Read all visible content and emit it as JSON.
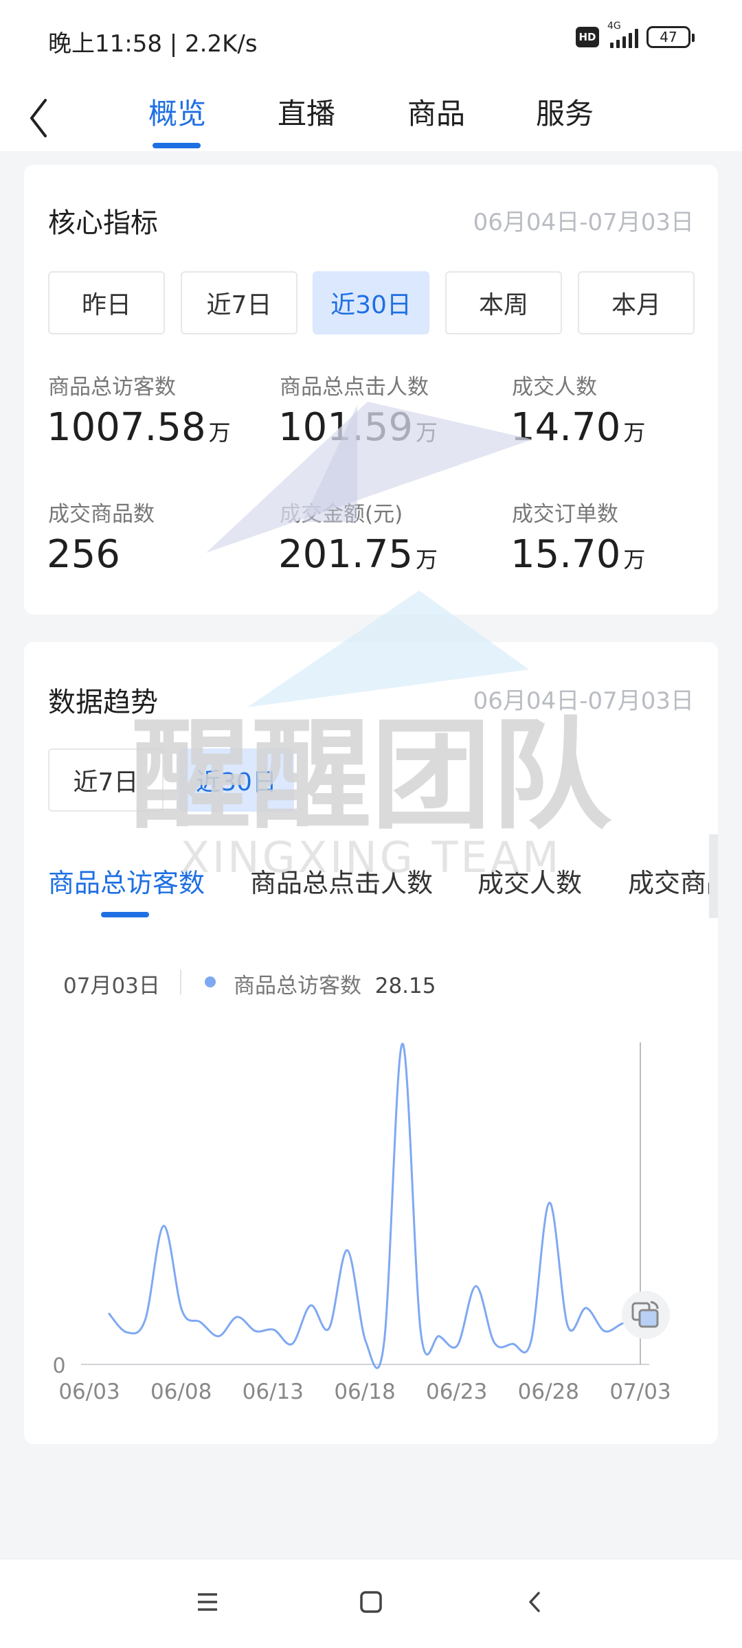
{
  "status_bar": {
    "time": "晚上11:58 | 2.2K/s",
    "network": "4G",
    "hd": "HD",
    "battery": "47"
  },
  "header": {
    "tabs": [
      {
        "label": "概览",
        "active": true
      },
      {
        "label": "直播",
        "active": false
      },
      {
        "label": "商品",
        "active": false
      },
      {
        "label": "服务",
        "active": false
      }
    ]
  },
  "core_metrics": {
    "title": "核心指标",
    "date_range": "06月04日-07月03日",
    "ranges": [
      "昨日",
      "近7日",
      "近30日",
      "本周",
      "本月"
    ],
    "selected_range": "近30日",
    "metrics": [
      {
        "label": "商品总访客数",
        "value": "1007.58",
        "unit": "万"
      },
      {
        "label": "商品总点击人数",
        "value": "101.59",
        "unit": "万"
      },
      {
        "label": "成交人数",
        "value": "14.70",
        "unit": "万"
      },
      {
        "label": "成交商品数",
        "value": "256",
        "unit": ""
      },
      {
        "label": "成交金额(元)",
        "value": "201.75",
        "unit": "万"
      },
      {
        "label": "成交订单数",
        "value": "15.70",
        "unit": "万"
      }
    ]
  },
  "data_trend": {
    "title": "数据趋势",
    "date_range": "06月04日-07月03日",
    "ranges": [
      "近7日",
      "近30日"
    ],
    "selected_range": "近30日",
    "metric_tabs": [
      "商品总访客数",
      "商品总点击人数",
      "成交人数",
      "成交商品"
    ],
    "active_metric": "商品总访客数",
    "tooltip": {
      "date": "07月03日",
      "series": "商品总访客数",
      "value": "28.15"
    }
  },
  "chart_data": {
    "type": "line",
    "series": [
      {
        "name": "商品总访客数",
        "color": "#7fa8f2"
      }
    ],
    "x_ticks": [
      "06/03",
      "06/08",
      "06/13",
      "06/18",
      "06/23",
      "06/28",
      "07/03"
    ],
    "y_ticks": [
      "0"
    ],
    "ylim": [
      0,
      250
    ],
    "points": [
      {
        "x": 0,
        "y": 40
      },
      {
        "x": 1,
        "y": 25
      },
      {
        "x": 2,
        "y": 35
      },
      {
        "x": 3,
        "y": 108
      },
      {
        "x": 4,
        "y": 42
      },
      {
        "x": 5,
        "y": 33
      },
      {
        "x": 6,
        "y": 22
      },
      {
        "x": 7,
        "y": 37
      },
      {
        "x": 8,
        "y": 26
      },
      {
        "x": 9,
        "y": 27
      },
      {
        "x": 10,
        "y": 16
      },
      {
        "x": 11,
        "y": 46
      },
      {
        "x": 12,
        "y": 28
      },
      {
        "x": 13,
        "y": 89
      },
      {
        "x": 14,
        "y": 18
      },
      {
        "x": 15,
        "y": 17
      },
      {
        "x": 16,
        "y": 250
      },
      {
        "x": 17,
        "y": 25
      },
      {
        "x": 18,
        "y": 22
      },
      {
        "x": 19,
        "y": 15
      },
      {
        "x": 20,
        "y": 61
      },
      {
        "x": 21,
        "y": 17
      },
      {
        "x": 22,
        "y": 16
      },
      {
        "x": 23,
        "y": 18
      },
      {
        "x": 24,
        "y": 126
      },
      {
        "x": 25,
        "y": 30
      },
      {
        "x": 26,
        "y": 44
      },
      {
        "x": 27,
        "y": 26
      },
      {
        "x": 28,
        "y": 32
      },
      {
        "x": 29,
        "y": 35
      }
    ],
    "cursor_x": 30
  },
  "watermark": {
    "line1": "醒醒团队",
    "line2": "XINGXING TEAM"
  }
}
